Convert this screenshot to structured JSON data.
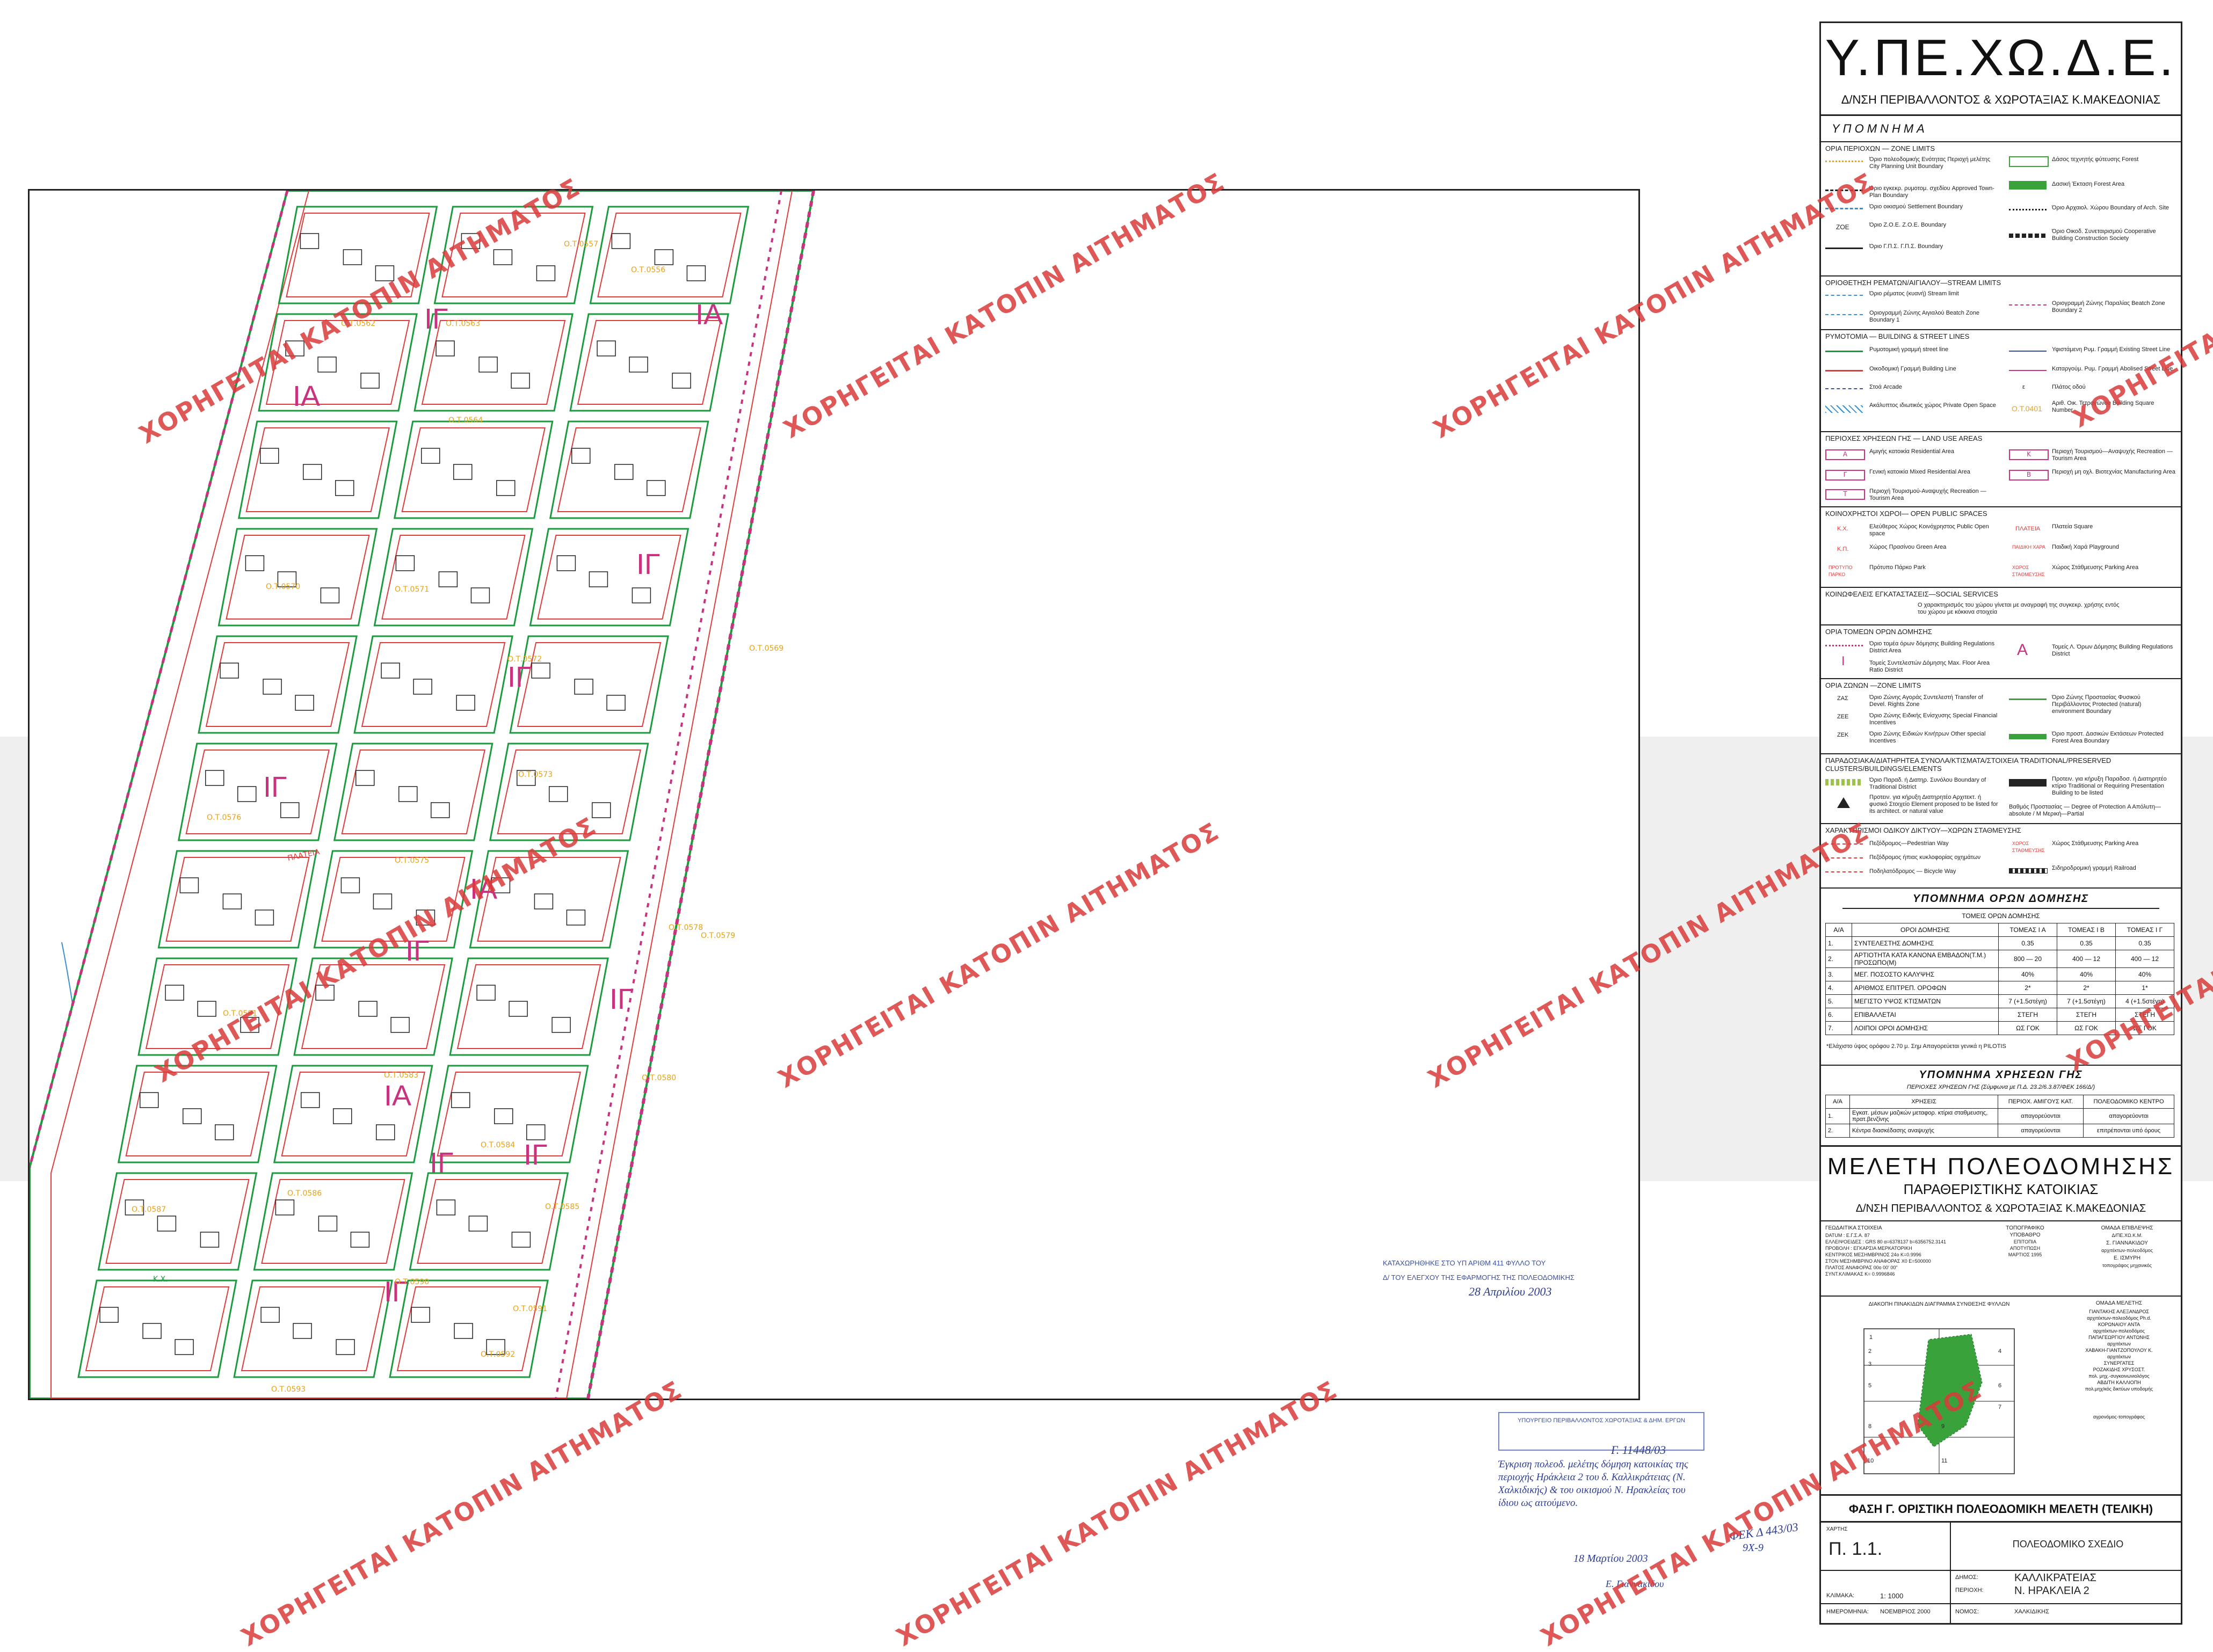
{
  "header": {
    "title": "Υ.ΠΕ.ΧΩ.Δ.Ε.",
    "subtitle": "Δ/ΝΣΗ ΠΕΡΙΒΑΛΛΟΝΤΟΣ & ΧΩΡΟΤΑΞΙΑΣ Κ.ΜΑΚΕΔΟΝΙΑΣ",
    "legend_title": "ΥΠΟΜΝΗΜΑ"
  },
  "watermark_text": "ΧΟΡΗΓΕΙΤΑΙ ΚΑΤΟΠΙΝ ΑΙΤΗΜΑΤΟΣ",
  "colors": {
    "street_line": "#1a9b3d",
    "building_line": "#e03a3a",
    "block_boundary": "#c8327e",
    "forest": "#3aa23a",
    "stream": "#3a8fd1",
    "zone_letters": "#c8327e",
    "block_numbers": "#e6a31a",
    "watermark": "#d93c3c",
    "stamp": "#3a4fa0"
  },
  "map": {
    "zone_labels": [
      "ΙΑ",
      "ΙΓ",
      "ΙΑ",
      "ΙΓ",
      "ΙΓ",
      "ΙΓ",
      "ΙΑ",
      "ΙΓ",
      "ΙΓ",
      "ΙΓ",
      "ΙΑ",
      "ΙΓ",
      "ΙΓ"
    ],
    "block_numbers": [
      "Ο.Τ.0557",
      "Ο.Τ.0556",
      "Ο.Τ.0563",
      "Ο.Τ.0562",
      "Ο.Τ.0564",
      "Ο.Τ.0570",
      "Ο.Τ.0571",
      "Ο.Τ.0572",
      "Ο.Τ.0573",
      "Ο.Τ.0569",
      "Ο.Τ.0576",
      "Ο.Τ.0575",
      "Ο.Τ.0578",
      "Ο.Τ.0579",
      "Ο.Τ.0581",
      "Ο.Τ.0583",
      "Ο.Τ.0580",
      "Ο.Τ.0584",
      "Ο.Τ.0585",
      "Ο.Τ.0586",
      "Ο.Τ.0587",
      "Ο.Τ.0590",
      "Ο.Τ.0591",
      "Ο.Τ.0593",
      "Ο.Τ.0592"
    ],
    "small_labels": {
      "square": "ΠΛΑΤΕΙΑ",
      "green": "Κ.Χ.",
      "parking": "ΧΩΡΟΣ ΣΤΑΘΜΕΥΣΗΣ",
      "region": "Α"
    }
  },
  "legend": {
    "zone_limits": {
      "title": "ΟΡΙΑ ΠΕΡΙΟΧΩΝ — ZONE LIMITS",
      "items": [
        {
          "label": "Όριο πολεοδομικής Ενότητας Περιοχή μελέτης City Planning Unit Boundary"
        },
        {
          "label": "Όριο εγκεκρ. ρυμοτομ. σχεδίου Approved Town-Plan Boundary"
        },
        {
          "label": "Όριο οικισμού Settlement Boundary"
        },
        {
          "label": "Όριο Ζ.Ο.Ε. Z.O.E. Boundary",
          "code": "ΖΟΕ"
        },
        {
          "label": "Όριο Γ.Π.Σ. Γ.Π.Σ. Boundary"
        },
        {
          "label": "Δάσος τεχνητής φύτευσης Forest"
        },
        {
          "label": "Δασική Έκταση Forest Area"
        },
        {
          "label": "Όριο Αρχαιολ. Χώρου Boundary of Arch. Site"
        },
        {
          "label": "Όριο Οικοδ. Συνεταιρισμού Cooperative Building Construction Society"
        }
      ]
    },
    "stream_limits": {
      "title": "ΟΡΙΟΘΕΤΗΣΗ ΡΕΜΑΤΩΝ/ΑΙΓΙΑΛΟΥ—STREAM LIMITS",
      "items": [
        {
          "label": "Όριο ρέματος (κυανή) Stream limit"
        },
        {
          "label": "Οριογραμμή Ζώνης Αιγιαλού Beatch Zone Boundary 1"
        },
        {
          "label": "Οριογραμμή Ζώνης Παραλίας Beatch Zone Boundary 2"
        }
      ]
    },
    "building_street": {
      "title": "ΡΥΜΟΤΟΜΙΑ — BUILDING & STREET LINES",
      "items": [
        {
          "label": "Ρυμοτομική γραμμή street line"
        },
        {
          "label": "Οικοδομική Γραμμή Building Line"
        },
        {
          "label": "Στοά Arcade"
        },
        {
          "label": "Ακάλυπτος ιδιωτικός χώρος Private Open Space"
        },
        {
          "label": "Υφιστάμενη Ρυμ. Γραμμή Existing Street Line"
        },
        {
          "label": "Καταργούμ. Ρυμ. Γραμμή Abolised Street Line"
        },
        {
          "label": "Πλάτος οδού",
          "code": "ε"
        },
        {
          "label": "Αριθ. Οικ. Τετραγώνου Building Square Number",
          "code": "Ο.Τ.0401"
        }
      ]
    },
    "land_use": {
      "title": "ΠΕΡΙΟΧΕΣ ΧΡΗΣΕΩΝ ΓΗΣ — LAND USE AREAS",
      "items": [
        {
          "label": "Αμιγής κατοικία Residential Area",
          "code": "Α"
        },
        {
          "label": "Γενική κατοικία Mixed Residential Area",
          "code": "Γ"
        },
        {
          "label": "Περιοχή Τουρισμού-Αναψυχής Recreation —Tourism Area",
          "code": "Τ"
        },
        {
          "label": "Περιοχή Τουρισμού—Αναψυχής Recreation —Tourism Area",
          "code": "Κ"
        },
        {
          "label": "Περιοχή μη οχλ. Βιοτεχνίας Manufacturing Area",
          "code": "Β"
        }
      ]
    },
    "open_spaces": {
      "title": "ΚΟΙΝΟΧΡΗΣΤΟΙ ΧΩΡΟΙ— OPEN PUBLIC SPACES",
      "items": [
        {
          "label": "Ελεύθερος Χώρος Κοινόχρηστος Public Open space",
          "code": "Κ.Χ."
        },
        {
          "label": "Χώρος Πρασίνου Green Area",
          "code": "Κ.Π."
        },
        {
          "label": "Πρότυπο Πάρκο Park",
          "code": "ΠΡΟΤΥΠΟ ΠΑΡΚΟ"
        },
        {
          "label": "Πλατεία Square",
          "code": "ΠΛΑΤΕΙΑ"
        },
        {
          "label": "Παιδική Χαρά Playground",
          "code": "ΠΑΙΔΙΚΗ ΧΑΡΑ"
        },
        {
          "label": "Χώρος Στάθμευσης Parking Area",
          "code": "ΧΩΡΟΣ ΣΤΑΘΜΕΥΣΗΣ"
        }
      ]
    },
    "social_services": {
      "title": "ΚΟΙΝΩΦΕΛΕΙΣ ΕΓΚΑΤΑΣΤΑΣΕΙΣ—SOCIAL SERVICES",
      "text": "Ο χαρακτηρισμός του χώρου γίνεται με αναγραφή της συγκεκρ. χρήσης εντός του χώρου με κόκκινα στοιχεία"
    },
    "building_regulations": {
      "title": "ΟΡΙΑ ΤΟΜΕΩΝ ΟΡΩΝ ΔΟΜΗΣΗΣ",
      "items": [
        {
          "label": "Όριο τομέα όρων δόμησης Building Regulations District Area"
        },
        {
          "label": "Τομείς Συντελεστών Δόμησης Max. Floor Area Ratio District",
          "code": "Ι"
        },
        {
          "label": "Τομείς Λ. Όρων Δόμησης Building Regulations District",
          "code": "Α"
        }
      ]
    },
    "zones": {
      "title": "ΟΡΙΑ ΖΩΝΩΝ —ZONE LIMITS",
      "items": [
        {
          "label": "Όριο Ζώνης Αγοράς Συντελεστή Transfer of Devel. Rights Zone",
          "code": "ΖΑΣ"
        },
        {
          "label": "Όριο Ζώνης Ειδικής Ενίσχυσης Special Financial Incentives",
          "code": "ΖΕΕ"
        },
        {
          "label": "Όριο Ζώνης Ειδικών Κινήτρων Other special Incentives",
          "code": "ΖΕΚ"
        },
        {
          "label": "Όριο Ζώνης Προστασίας Φυσικού Περιβάλλοντος Protected (natural) environment Boundary"
        },
        {
          "label": "Όριο προστ. Δασικών Εκτάσεων Protected Forest Area Boundary"
        }
      ]
    },
    "traditional": {
      "title": "ΠΑΡΑΔΟΣΙΑΚΑ/ΔΙΑΤΗΡΗΤΕΑ ΣΥΝΟΛΑ/ΚΤΙΣΜΑΤΑ/ΣΤΟΙΧΕΙΑ TRADITIONAL/PRESERVED CLUSTERS/BUILDINGS/ELEMENTS",
      "items": [
        {
          "label": "Όριο Παραδ. ή Διατηρ. Συνόλου Boundary of Traditional District"
        },
        {
          "label": "Προτειν. για κήρυξη Διατηρητέο Αρχιτεκτ. ή φυσικό Στοιχείο Element proposed to be listed for its architect. or natural value"
        },
        {
          "label": "Προτειν. για κήρυξη Παραδοσ. ή Διατηρητέο κτίριο Traditional or Requiring Presentation Building to be listed"
        },
        {
          "label": "Βαθμός Προστασίας — Degree of Protection Α Απόλυτη—absolute / Μ Μερική—Partial"
        }
      ]
    },
    "road_network": {
      "title": "ΧΑΡΑΚΤΗΡΙΣΜΟΙ ΟΔΙΚΟΥ ΔΙΚΤΥΟΥ—ΧΩΡΩΝ ΣΤΑΘΜΕΥΣΗΣ",
      "items": [
        {
          "label": "Πεζόδρομος—Pedestrian Way"
        },
        {
          "label": "Πεζόδρομος ήπιας κυκλοφορίας οχημάτων"
        },
        {
          "label": "Ποδηλατόδρομος — Bicycle Way"
        },
        {
          "label": "Χώρος Στάθμευσης Parking Area",
          "code": "ΧΩΡΟΣ ΣΤΑΘΜΕΥΣΗΣ"
        },
        {
          "label": "Σιδηροδρομική γραμμή Railroad"
        }
      ]
    }
  },
  "terms_table": {
    "title": "ΥΠΟΜΝΗΜΑ ΟΡΩΝ ΔΟΜΗΣΗΣ",
    "subtitle": "ΤΟΜΕΙΣ ΟΡΩΝ ΔΟΜΗΣΗΣ",
    "headers": [
      "Α/Α",
      "ΟΡΟΙ ΔΟΜΗΣΗΣ",
      "ΤΟΜΕΑΣ Ι Α",
      "ΤΟΜΕΑΣ Ι Β",
      "ΤΟΜΕΑΣ Ι Γ"
    ],
    "rows": [
      [
        "1.",
        "ΣΥΝΤΕΛΕΣΤΗΣ ΔΟΜΗΣΗΣ",
        "0.35",
        "0.35",
        "0.35"
      ],
      [
        "2.",
        "ΑΡΤΙΟΤΗΤΑ ΚΑΤΑ ΚΑΝΟΝΑ ΕΜΒΑΔΟΝ(Τ.Μ.) ΠΡΟΣΩΠΟ(Μ)",
        "800 — 20",
        "400 — 12",
        "400 — 12"
      ],
      [
        "3.",
        "ΜΕΓ. ΠΟΣΟΣΤΟ ΚΑΛΥΨΗΣ",
        "40%",
        "40%",
        "40%"
      ],
      [
        "4.",
        "ΑΡΙΘΜΟΣ ΕΠΙΤΡΕΠ. ΟΡΟΦΩΝ",
        "2*",
        "2*",
        "1*"
      ],
      [
        "5.",
        "ΜΕΓΙΣΤΟ ΥΨΟΣ ΚΤΙΣΜΑΤΩΝ",
        "7 (+1.5στέγη)",
        "7 (+1.5στέγη)",
        "4 (+1.5στέγη)"
      ],
      [
        "6.",
        "ΕΠΙΒΑΛΛΕΤΑΙ",
        "ΣΤΕΓΗ",
        "ΣΤΕΓΗ",
        "ΣΤΕΓΗ"
      ],
      [
        "7.",
        "ΛΟΙΠΟΙ ΟΡΟΙ ΔΟΜΗΣΗΣ",
        "ΩΣ ΓΟΚ",
        "ΩΣ ΓΟΚ",
        "ΩΣ ΓΟΚ"
      ]
    ],
    "footnote": "*Ελάχιστο ύψος ορόφου 2.70 μ. Σημ Απαγορεύεται γενικά η PILOTIS"
  },
  "land_use_table": {
    "title": "ΥΠΟΜΝΗΜΑ ΧΡΗΣΕΩΝ ΓΗΣ",
    "subtitle": "ΠΕΡΙΟΧΕΣ ΧΡΗΣΕΩΝ ΓΗΣ (Σύμφωνα με Π.Δ. 23.2/6.3.87/ΦΕΚ 166/Δ/)",
    "headers": [
      "Α/Α",
      "ΧΡΗΣΕΙΣ",
      "ΠΕΡΙΟΧ. ΑΜΙΓΟΥΣ ΚΑΤ.",
      "ΠΟΛΕΟΔΟΜΙΚΟ ΚΕΝΤΡΟ"
    ],
    "rows": [
      [
        "1.",
        "Εγκατ. μέσων μαζικών μεταφορ. κτίρια σταθμευσης, πρατ.βενζίνης",
        "απαγορεύονται",
        "απαγορεύονται"
      ],
      [
        "2.",
        "Κέντρα διασκέδασης αναψυχής",
        "απαγορεύονται",
        "επιτρέπονται υπό όρους"
      ]
    ]
  },
  "study": {
    "title": "ΜΕΛΕΤΗ ΠΟΛΕΟΔΟΜΗΣΗΣ",
    "subtitle": "ΠΑΡΑΘΕΡΙΣΤΙΚΗΣ ΚΑΤΟΙΚΙΑΣ",
    "authority": "Δ/ΝΣΗ ΠΕΡΙΒΑΛΛΟΝΤΟΣ & ΧΩΡΟΤΑΞΙΑΣ Κ.ΜΑΚΕΔΟΝΙΑΣ",
    "geodetic_title": "ΓΕΩΔΑΙΤΙΚΑ ΣΤΟΙΧΕΙΑ",
    "geodetic_lines": [
      "DATUM : Ε.Γ.Σ.Α. 87",
      "ΕΛΛΕΙΨΟΕΙΔΕΣ : GRS 80 α=6378137 b=6356752.3141",
      "ΠΡΟΒΟΛΗ : ΕΓΚΑΡΣΙΑ ΜΕΡΚΑΤΟΡΙΚΗ",
      "ΚΕΝΤΡΙΚΟΣ ΜΕΣΗΜΒΡΙΝΟΣ 24ο Κ=0.9996",
      "ΣΤΟΝ ΜΕΣΗΜΒΡΙΝΟ ΑΝΑΦΟΡΑΣ Χ0 Ε=500000",
      "ΠΛΑΤΟΣ ΑΝΑΦΟΡΑΣ 00ο 00' 00\"",
      "ΣΥΝΤ.ΚΛΙΜΑΚΑΣ Κ= 0.9996846"
    ],
    "topographic_title": "ΤΟΠΟΓΡΑΦΙΚΟ ΥΠΟΒΑΘΡΟ",
    "topographic_lines": [
      "ΕΠΙΤΟΠΙΑ",
      "ΑΠΟΤΥΠΩΣΗ",
      "ΜΑΡΤΙΟΣ 1995"
    ],
    "supervision_title": "ΟΜΑΔΑ ΕΠΙΒΛΕΨΗΣ",
    "supervision_lines": [
      "Δ/ΠΕ.ΧΩ.Κ.Μ.",
      "Σ. ΓΙΑΝΝΑΚΙΔΟΥ",
      "αρχιτέκτων-πολεοδόμος",
      "Ε. ΙΣΜΥΡΗ",
      "τοπογράφος μηχανικός"
    ],
    "study_team_title": "ΟΜΑΔΑ ΜΕΛΕΤΗΣ",
    "study_team_lines": [
      "ΓΙΑΝΤΑΚΗΣ ΑΛΕΞΑΝΔΡΟΣ",
      "αρχιτέκτων-πολεοδόμος Ph.d.",
      "ΚΟΡΩΝΑΙΟΥ ΑΝΤΑ",
      "αρχιτέκτων-πολεοδόμος",
      "ΠΑΠΑΓΕΩΡΓΙΟΥ ΑΝΤΩΝΗΣ",
      "αρχιτέκτων",
      "ΧΑΒΑΚΗ-ΓΙΑΝΤΖΟΠΟΥΛΟΥ Κ.",
      "αρχιτέκτων",
      "ΣΥΝΕΡΓΑΤΕΣ",
      "ΡΟΖΑΚΙΔΗΣ ΧΡΥΣΟΣΤ.",
      "πολ. μηχ.-συγκοινωνιολόγος",
      "ΑΒΔΙΤΗ ΚΑΛΛΙΟΠΗ",
      "πολ.μηχ/κός δικτύων υποδομής",
      "αγρονόμος-τοπογράφος"
    ],
    "index_title": "ΔΙΑΚΟΠΗ ΠΙΝΑΚΙΔΩΝ ΔΙΑΓΡΑΜΜΑ ΣΥΝΘΕΣΗΣ ΦΥΛΛΩΝ",
    "index_sheets": [
      "1",
      "2",
      "3",
      "4",
      "5",
      "6",
      "7",
      "8",
      "9",
      "10",
      "11"
    ],
    "phase": "ΦΑΣΗ Γ.   ΟΡΙΣΤΙΚΗ ΠΟΛΕΟΔΟΜΙΚΗ ΜΕΛΕΤΗ (ΤΕΛΙΚΗ)",
    "map_label": "ΧΑΡΤΗΣ",
    "map_number": "Π. 1.1.",
    "plan_title": "ΠΟΛΕΟΔΟΜΙΚΟ ΣΧΕΔΙΟ",
    "municipality_label": "ΔΗΜΟΣ:",
    "municipality": "ΚΑΛΛΙΚΡΑΤΕΙΑΣ",
    "area_label": "ΠΕΡΙΟΧΗ:",
    "area": "Ν. ΗΡΑΚΛΕΙΑ 2",
    "prefecture_label": "ΝΟΜΟΣ:",
    "prefecture": "ΧΑΛΚΙΔΙΚΗΣ",
    "scale_label": "ΚΛΙΜΑΚΑ:",
    "scale": "1: 1000",
    "date_label": "ΗΜΕΡΟΜΗΝΙΑ:",
    "date": "ΝΟΕΜΒΡΙΟΣ 2000"
  },
  "stamps": {
    "approval_line1": "ΚΑΤΑΧΩΡΗΘΗΚΕ ΣΤΟ ΥΠ ΑΡΙΘΜ    411    ΦΥΛΛΟ ΤΟΥ",
    "approval_line2": "Δ/    ΤΟΥ ΕΛΕΓΧΟΥ ΤΗΣ ΕΦΑΡΜΟΓΗΣ ΤΗΣ ΠΟΛΕΟΔΟΜΙΚΗΣ",
    "approval_date": "28 Απριλίου 2003",
    "dept_header": "ΥΠΟΥΡΓΕΙΟ ΠΕΡΙΒΑΛΛΟΝΤΟΣ ΧΩΡΟΤΑΞΙΑΣ & ΔΗΜ. ΕΡΓΩΝ",
    "decision_ref": "Γ. 11448/03",
    "decision_text": "Έγκριση πολεοδ. μελέτης δόμηση κατοικίας της περιοχής Ηράκλεια 2 του δ. Καλλικράτειας (Ν. Χαλκιδικής) & του οικισμού Ν. Ηρακλείας του ίδιου ως αιτούμενο.",
    "stamp_date": "18 Μαρτίου 2003",
    "fek_note": "ΦΕΚ Δ 443/03",
    "fek_note2": "9Χ-9",
    "signature": "Ε. Γιαννακίδου"
  }
}
